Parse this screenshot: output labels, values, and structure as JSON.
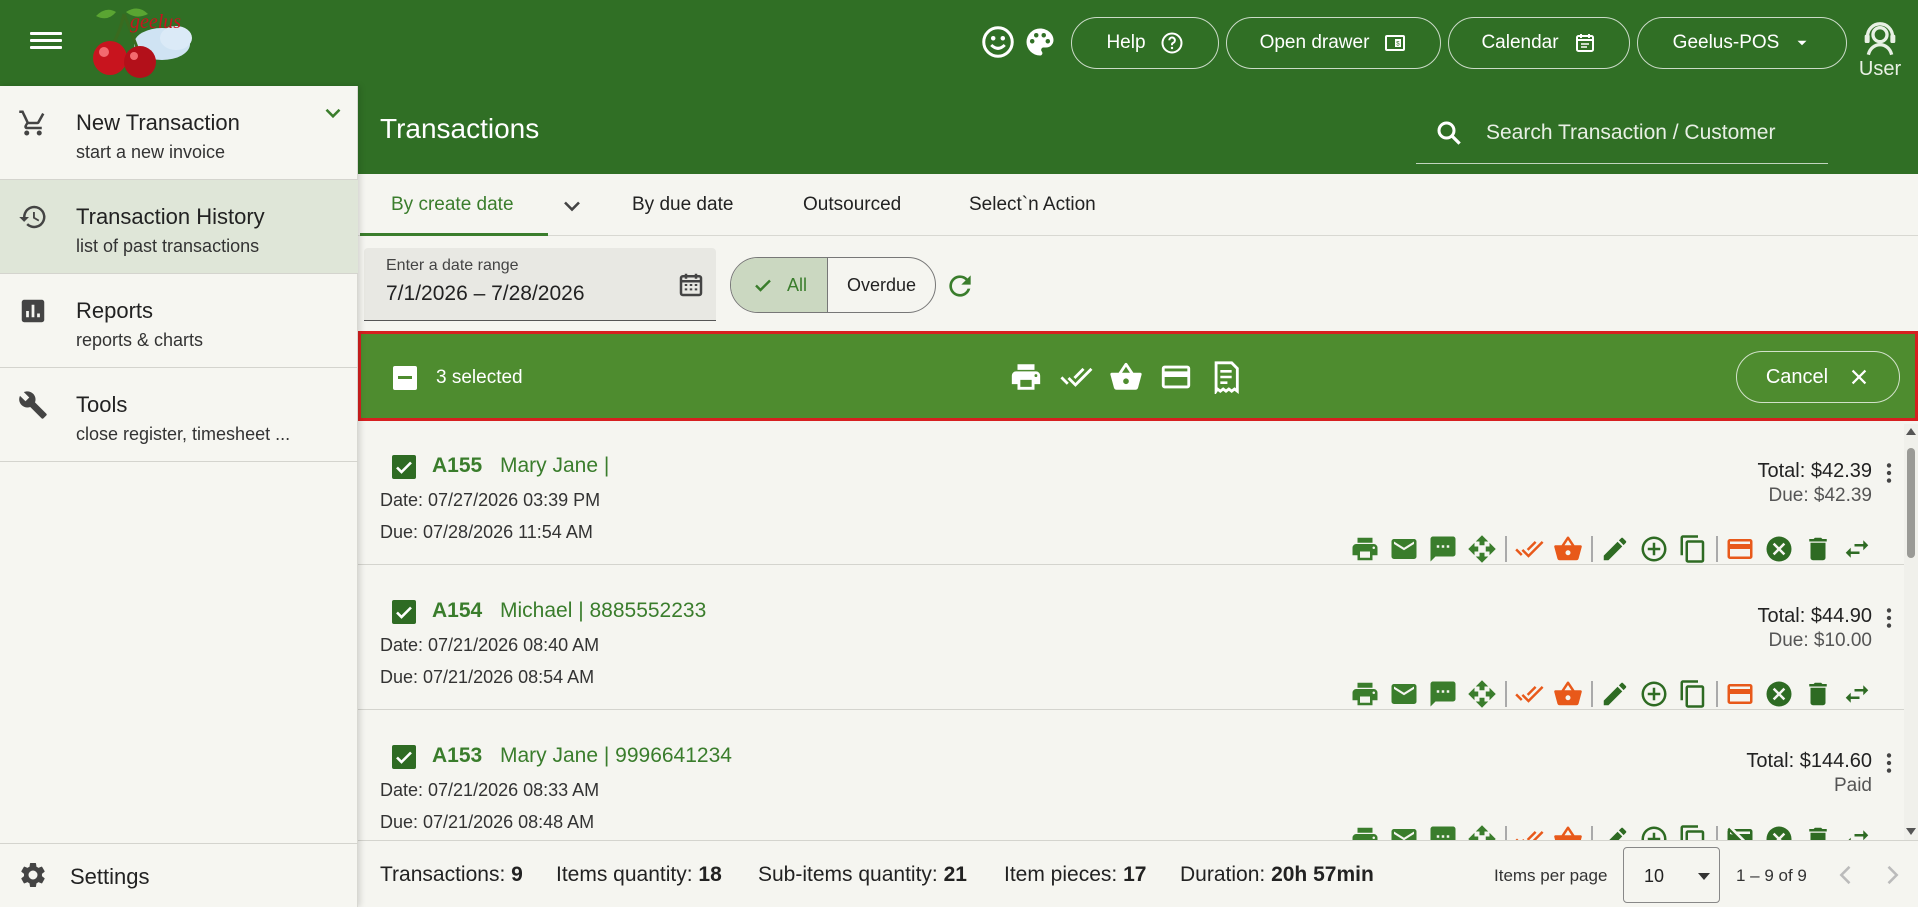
{
  "app": {
    "brand": "geelus",
    "help_label": "Help",
    "open_drawer_label": "Open drawer",
    "calendar_label": "Calendar",
    "pos_label": "Geelus-POS",
    "user_label": "User"
  },
  "sidebar": {
    "items": [
      {
        "title": "New Transaction",
        "subtitle": "start a new invoice",
        "icon": "cart-icon"
      },
      {
        "title": "Transaction History",
        "subtitle": "list of past transactions",
        "icon": "history-icon"
      },
      {
        "title": "Reports",
        "subtitle": "reports & charts",
        "icon": "chart-icon"
      },
      {
        "title": "Tools",
        "subtitle": "close register, timesheet ...",
        "icon": "wrench-icon"
      }
    ],
    "settings_label": "Settings"
  },
  "header": {
    "title": "Transactions",
    "search_placeholder": "Search Transaction / Customer"
  },
  "tabs": [
    {
      "label": "By create date",
      "active": true
    },
    {
      "label": "By due date",
      "active": false
    },
    {
      "label": "Outsourced",
      "active": false
    },
    {
      "label": "Select`n Action",
      "active": false
    }
  ],
  "filters": {
    "date_label": "Enter a date range",
    "date_value": "7/1/2026  – 7/28/2026",
    "toggle_all": "All",
    "toggle_overdue": "Overdue"
  },
  "selection": {
    "count_label": "3 selected",
    "cancel_label": "Cancel"
  },
  "transactions": [
    {
      "id": "A155",
      "customer": "Mary Jane |",
      "date": "Date: 07/27/2026 03:39 PM",
      "due": "Due: 07/28/2026 11:54 AM",
      "total": "Total: $42.39",
      "status": "Due: $42.39",
      "checked": true
    },
    {
      "id": "A154",
      "customer": "Michael | 8885552233",
      "date": "Date: 07/21/2026 08:40 AM",
      "due": "Due: 07/21/2026 08:54 AM",
      "total": "Total: $44.90",
      "status": "Due: $10.00",
      "checked": true
    },
    {
      "id": "A153",
      "customer": "Mary Jane | 9996641234",
      "date": "Date: 07/21/2026 08:33 AM",
      "due": "Due: 07/21/2026 08:48 AM",
      "total": "Total: $144.60",
      "status": "Paid",
      "checked": true
    }
  ],
  "footer": {
    "transactions_label": "Transactions:",
    "transactions_value": "9",
    "items_label": "Items quantity:",
    "items_value": "18",
    "subitems_label": "Sub-items quantity:",
    "subitems_value": "21",
    "pieces_label": "Item pieces:",
    "pieces_value": "17",
    "duration_label": "Duration:",
    "duration_value": "20h 57min",
    "items_per_page_label": "Items per page",
    "items_per_page_value": "10",
    "range_label": "1 – 9 of 9"
  },
  "colors": {
    "primary": "#306f25",
    "selection_bar": "#4e8c2f",
    "accent_green": "#3a7d2c",
    "accent_orange": "#e8591a",
    "highlight_border": "#d62020"
  }
}
